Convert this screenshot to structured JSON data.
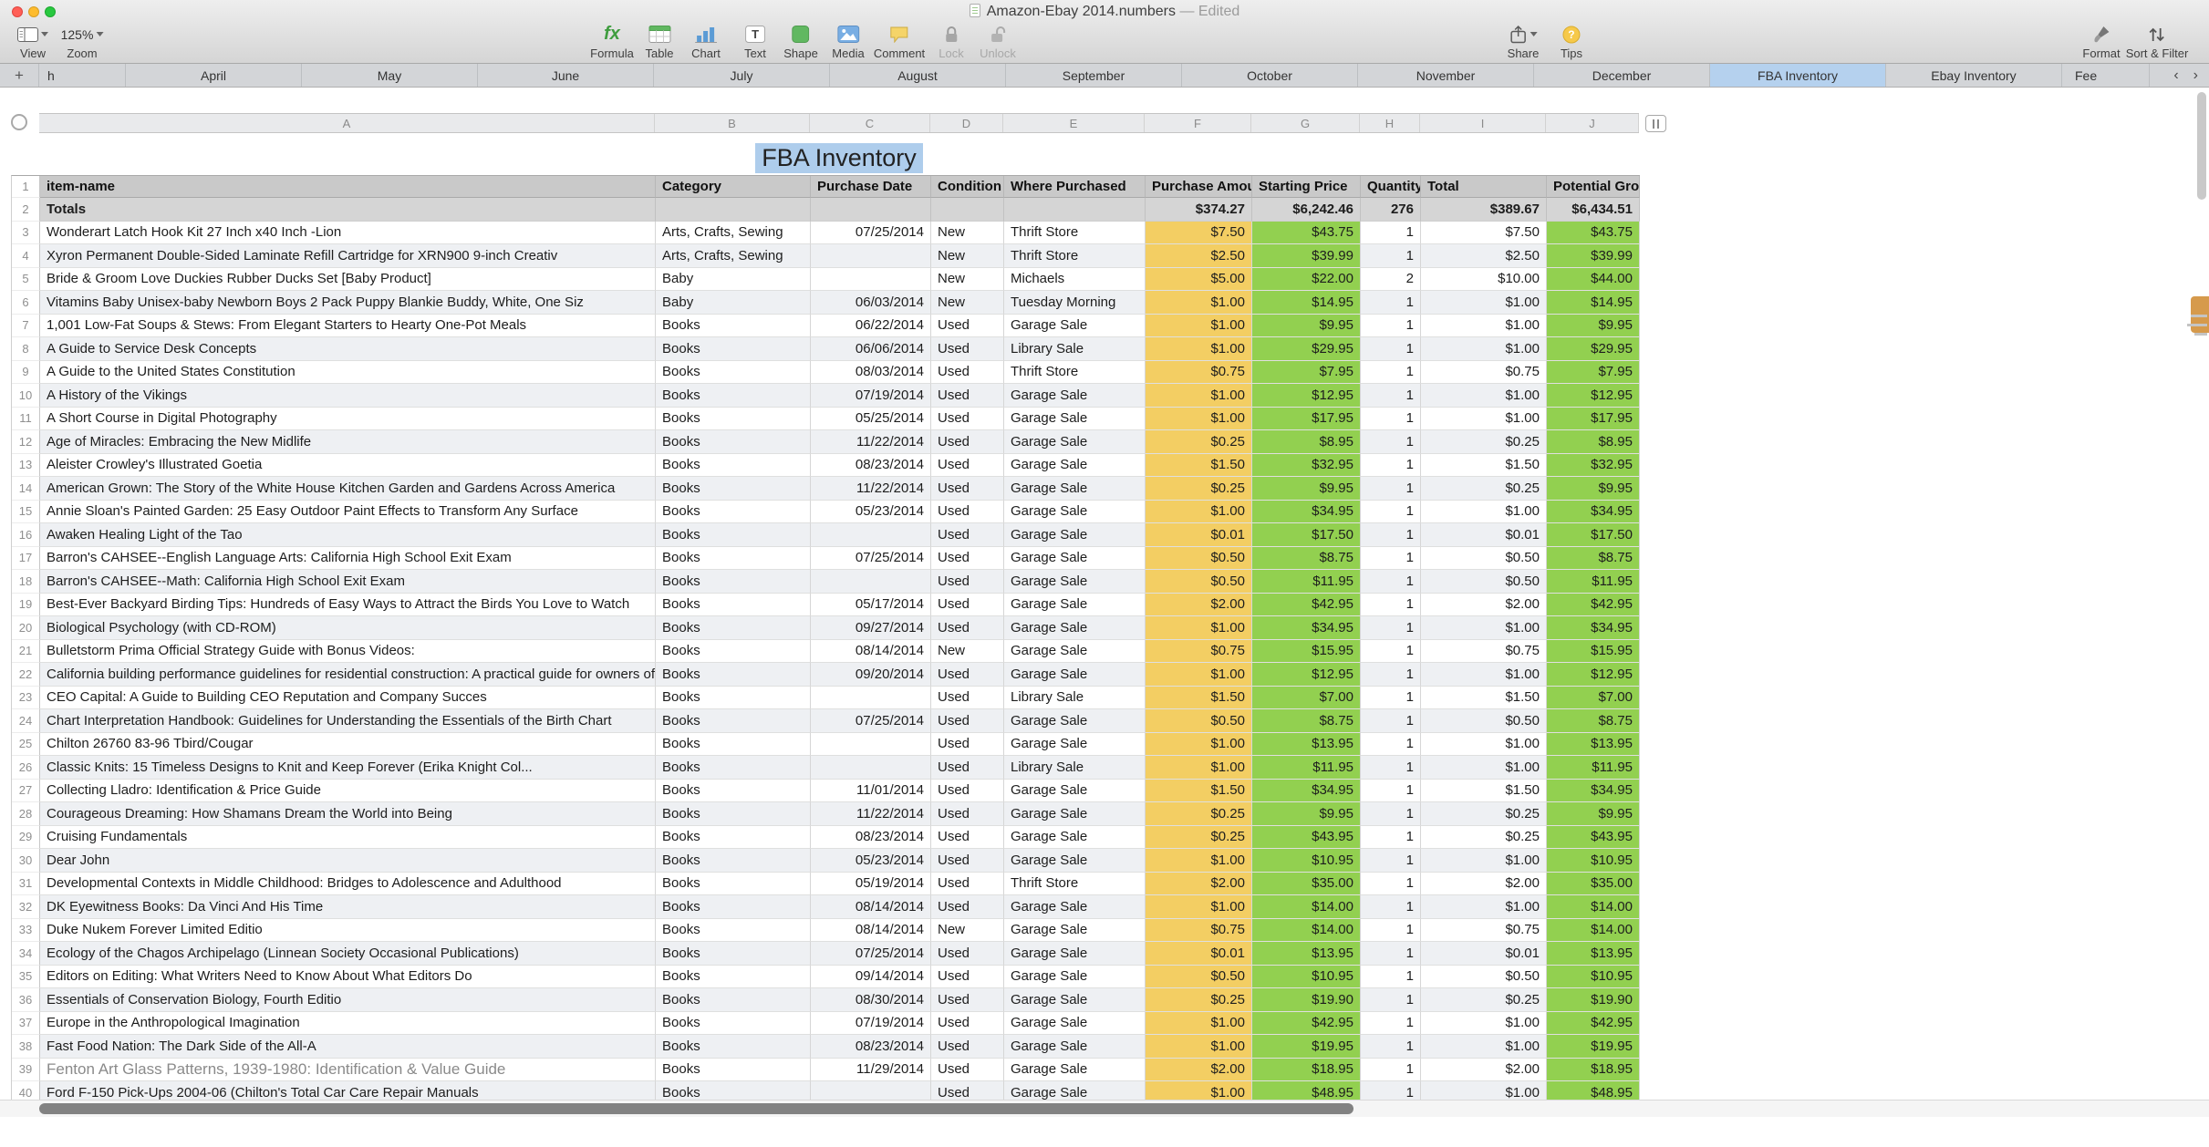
{
  "window": {
    "title": "Amazon-Ebay 2014.numbers",
    "edited": "— Edited"
  },
  "toolbar": {
    "view": "View",
    "zoom_label": "Zoom",
    "zoom_value": "125%",
    "formula": "Formula",
    "table": "Table",
    "chart": "Chart",
    "text": "Text",
    "shape": "Shape",
    "media": "Media",
    "comment": "Comment",
    "lock": "Lock",
    "unlock": "Unlock",
    "share": "Share",
    "tips": "Tips",
    "format": "Format",
    "sort_filter": "Sort & Filter"
  },
  "tabs": {
    "partial_first": "h",
    "items": [
      "April",
      "May",
      "June",
      "July",
      "August",
      "September",
      "October",
      "November",
      "December",
      "FBA Inventory",
      "Ebay Inventory"
    ],
    "partial_last": "Fee",
    "active": "FBA Inventory"
  },
  "sheet": {
    "title": "FBA Inventory",
    "column_letters": [
      "A",
      "B",
      "C",
      "D",
      "E",
      "F",
      "G",
      "H",
      "I",
      "J"
    ],
    "columns": [
      "item-name",
      "Category",
      "Purchase Date",
      "Condition",
      "Where Purchased",
      "Purchase Amount",
      "Starting Price",
      "Quantity",
      "Total",
      "Potential Gross"
    ],
    "totals": [
      "Totals",
      "",
      "",
      "",
      "",
      "$374.27",
      "$6,242.46",
      "276",
      "$389.67",
      "$6,434.51"
    ],
    "muted_item_row": 39,
    "rows": [
      [
        "Wonderart Latch Hook Kit 27 Inch x40 Inch -Lion",
        "Arts, Crafts, Sewing",
        "07/25/2014",
        "New",
        "Thrift Store",
        "$7.50",
        "$43.75",
        "1",
        "$7.50",
        "$43.75"
      ],
      [
        "Xyron Permanent Double-Sided Laminate Refill Cartridge for XRN900 9-inch Creativ",
        "Arts, Crafts, Sewing",
        "",
        "New",
        "Thrift Store",
        "$2.50",
        "$39.99",
        "1",
        "$2.50",
        "$39.99"
      ],
      [
        "Bride & Groom Love Duckies Rubber Ducks Set [Baby Product]",
        "Baby",
        "",
        "New",
        "Michaels",
        "$5.00",
        "$22.00",
        "2",
        "$10.00",
        "$44.00"
      ],
      [
        "Vitamins Baby Unisex-baby Newborn Boys 2 Pack Puppy Blankie Buddy, White, One Siz",
        "Baby",
        "06/03/2014",
        "New",
        "Tuesday Morning",
        "$1.00",
        "$14.95",
        "1",
        "$1.00",
        "$14.95"
      ],
      [
        "1,001 Low-Fat Soups & Stews: From Elegant Starters to Hearty One-Pot Meals",
        "Books",
        "06/22/2014",
        "Used",
        "Garage Sale",
        "$1.00",
        "$9.95",
        "1",
        "$1.00",
        "$9.95"
      ],
      [
        "A Guide to Service Desk Concepts",
        "Books",
        "06/06/2014",
        "Used",
        "Library Sale",
        "$1.00",
        "$29.95",
        "1",
        "$1.00",
        "$29.95"
      ],
      [
        "A Guide to the United States Constitution",
        "Books",
        "08/03/2014",
        "Used",
        "Thrift Store",
        "$0.75",
        "$7.95",
        "1",
        "$0.75",
        "$7.95"
      ],
      [
        "A History of the Vikings",
        "Books",
        "07/19/2014",
        "Used",
        "Garage Sale",
        "$1.00",
        "$12.95",
        "1",
        "$1.00",
        "$12.95"
      ],
      [
        "A Short Course in Digital Photography",
        "Books",
        "05/25/2014",
        "Used",
        "Garage Sale",
        "$1.00",
        "$17.95",
        "1",
        "$1.00",
        "$17.95"
      ],
      [
        "Age of Miracles: Embracing the New Midlife",
        "Books",
        "11/22/2014",
        "Used",
        "Garage Sale",
        "$0.25",
        "$8.95",
        "1",
        "$0.25",
        "$8.95"
      ],
      [
        "Aleister Crowley's Illustrated Goetia",
        "Books",
        "08/23/2014",
        "Used",
        "Garage Sale",
        "$1.50",
        "$32.95",
        "1",
        "$1.50",
        "$32.95"
      ],
      [
        "American Grown: The Story of the White House Kitchen Garden and Gardens Across America",
        "Books",
        "11/22/2014",
        "Used",
        "Garage Sale",
        "$0.25",
        "$9.95",
        "1",
        "$0.25",
        "$9.95"
      ],
      [
        "Annie Sloan's Painted Garden: 25 Easy Outdoor Paint Effects to Transform Any Surface",
        "Books",
        "05/23/2014",
        "Used",
        "Garage Sale",
        "$1.00",
        "$34.95",
        "1",
        "$1.00",
        "$34.95"
      ],
      [
        "Awaken Healing Light of the Tao",
        "Books",
        "",
        "Used",
        "Garage Sale",
        "$0.01",
        "$17.50",
        "1",
        "$0.01",
        "$17.50"
      ],
      [
        "Barron's CAHSEE--English Language Arts: California High School Exit Exam",
        "Books",
        "07/25/2014",
        "Used",
        "Garage Sale",
        "$0.50",
        "$8.75",
        "1",
        "$0.50",
        "$8.75"
      ],
      [
        "Barron's CAHSEE--Math: California High School Exit Exam",
        "Books",
        "",
        "Used",
        "Garage Sale",
        "$0.50",
        "$11.95",
        "1",
        "$0.50",
        "$11.95"
      ],
      [
        "Best-Ever Backyard Birding Tips: Hundreds of Easy Ways to Attract the Birds You Love to Watch",
        "Books",
        "05/17/2014",
        "Used",
        "Garage Sale",
        "$2.00",
        "$42.95",
        "1",
        "$2.00",
        "$42.95"
      ],
      [
        "Biological Psychology (with CD-ROM)",
        "Books",
        "09/27/2014",
        "Used",
        "Garage Sale",
        "$1.00",
        "$34.95",
        "1",
        "$1.00",
        "$34.95"
      ],
      [
        "Bulletstorm Prima Official Strategy Guide with Bonus Videos:",
        "Books",
        "08/14/2014",
        "New",
        "Garage Sale",
        "$0.75",
        "$15.95",
        "1",
        "$0.75",
        "$15.95"
      ],
      [
        "California building performance guidelines for residential construction: A practical guide for owners of new homes : constr",
        "Books",
        "09/20/2014",
        "Used",
        "Garage Sale",
        "$1.00",
        "$12.95",
        "1",
        "$1.00",
        "$12.95"
      ],
      [
        "CEO Capital: A Guide to Building CEO Reputation and Company Succes",
        "Books",
        "",
        "Used",
        "Library Sale",
        "$1.50",
        "$7.00",
        "1",
        "$1.50",
        "$7.00"
      ],
      [
        "Chart Interpretation Handbook: Guidelines for Understanding the Essentials of the Birth Chart",
        "Books",
        "07/25/2014",
        "Used",
        "Garage Sale",
        "$0.50",
        "$8.75",
        "1",
        "$0.50",
        "$8.75"
      ],
      [
        "Chilton 26760 83-96 Tbird/Cougar",
        "Books",
        "",
        "Used",
        "Garage Sale",
        "$1.00",
        "$13.95",
        "1",
        "$1.00",
        "$13.95"
      ],
      [
        "Classic Knits: 15 Timeless Designs to Knit and Keep Forever (Erika Knight Col...",
        "Books",
        "",
        "Used",
        "Library Sale",
        "$1.00",
        "$11.95",
        "1",
        "$1.00",
        "$11.95"
      ],
      [
        "Collecting Lladro: Identification & Price Guide",
        "Books",
        "11/01/2014",
        "Used",
        "Garage Sale",
        "$1.50",
        "$34.95",
        "1",
        "$1.50",
        "$34.95"
      ],
      [
        "Courageous Dreaming: How Shamans Dream the World into Being",
        "Books",
        "11/22/2014",
        "Used",
        "Garage Sale",
        "$0.25",
        "$9.95",
        "1",
        "$0.25",
        "$9.95"
      ],
      [
        "Cruising Fundamentals",
        "Books",
        "08/23/2014",
        "Used",
        "Garage Sale",
        "$0.25",
        "$43.95",
        "1",
        "$0.25",
        "$43.95"
      ],
      [
        "Dear John",
        "Books",
        "05/23/2014",
        "Used",
        "Garage Sale",
        "$1.00",
        "$10.95",
        "1",
        "$1.00",
        "$10.95"
      ],
      [
        "Developmental Contexts in Middle Childhood: Bridges to Adolescence and Adulthood",
        "Books",
        "05/19/2014",
        "Used",
        "Thrift Store",
        "$2.00",
        "$35.00",
        "1",
        "$2.00",
        "$35.00"
      ],
      [
        "DK Eyewitness Books: Da Vinci And His Time",
        "Books",
        "08/14/2014",
        "Used",
        "Garage Sale",
        "$1.00",
        "$14.00",
        "1",
        "$1.00",
        "$14.00"
      ],
      [
        "Duke Nukem Forever Limited Editio",
        "Books",
        "08/14/2014",
        "New",
        "Garage Sale",
        "$0.75",
        "$14.00",
        "1",
        "$0.75",
        "$14.00"
      ],
      [
        "Ecology of the Chagos Archipelago (Linnean Society Occasional Publications)",
        "Books",
        "07/25/2014",
        "Used",
        "Garage Sale",
        "$0.01",
        "$13.95",
        "1",
        "$0.01",
        "$13.95"
      ],
      [
        "Editors on Editing: What Writers Need to Know About What Editors Do",
        "Books",
        "09/14/2014",
        "Used",
        "Garage Sale",
        "$0.50",
        "$10.95",
        "1",
        "$0.50",
        "$10.95"
      ],
      [
        "Essentials of Conservation Biology, Fourth Editio",
        "Books",
        "08/30/2014",
        "Used",
        "Garage Sale",
        "$0.25",
        "$19.90",
        "1",
        "$0.25",
        "$19.90"
      ],
      [
        "Europe in the Anthropological Imagination",
        "Books",
        "07/19/2014",
        "Used",
        "Garage Sale",
        "$1.00",
        "$42.95",
        "1",
        "$1.00",
        "$42.95"
      ],
      [
        "Fast Food Nation: The Dark Side of the All-A",
        "Books",
        "08/23/2014",
        "Used",
        "Garage Sale",
        "$1.00",
        "$19.95",
        "1",
        "$1.00",
        "$19.95"
      ],
      [
        "Fenton Art Glass Patterns, 1939-1980: Identification & Value Guide",
        "Books",
        "11/29/2014",
        "Used",
        "Garage Sale",
        "$2.00",
        "$18.95",
        "1",
        "$2.00",
        "$18.95"
      ],
      [
        "Ford F-150 Pick-Ups 2004-06 (Chilton's Total Car Care Repair Manuals",
        "Books",
        "",
        "Used",
        "Garage Sale",
        "$1.00",
        "$48.95",
        "1",
        "$1.00",
        "$48.95"
      ]
    ]
  },
  "colors": {
    "fill-yellow": "#f3ce63",
    "fill-green": "#92d050",
    "tab-active": "#b5d1ee",
    "selection": "#aecdec"
  }
}
